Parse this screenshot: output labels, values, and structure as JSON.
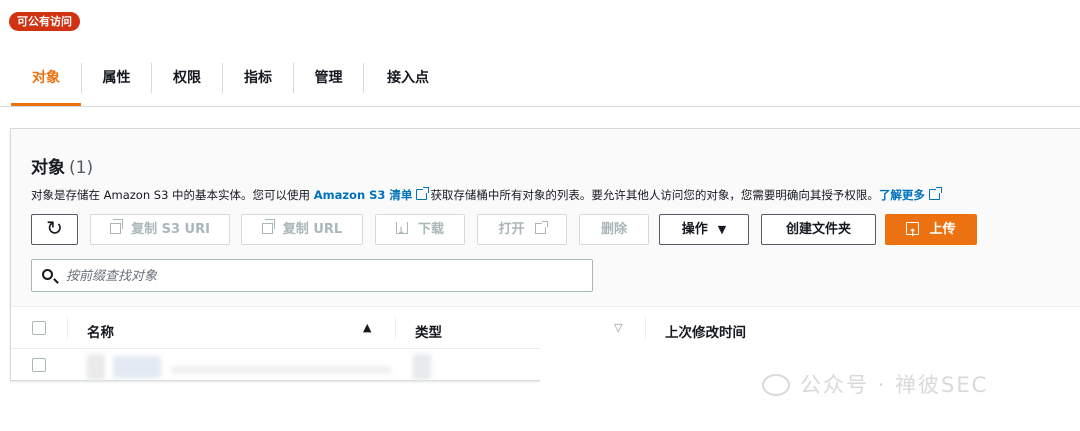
{
  "badge": {
    "label": "可公有访问"
  },
  "tabs": [
    {
      "label": "对象",
      "active": true
    },
    {
      "label": "属性"
    },
    {
      "label": "权限"
    },
    {
      "label": "指标"
    },
    {
      "label": "管理"
    },
    {
      "label": "接入点"
    }
  ],
  "objects": {
    "title": "对象",
    "count": "(1)",
    "description": {
      "prefix": "对象是存储在 Amazon S3 中的基本实体。您可以使用",
      "link1": "Amazon S3 清单",
      "middle": "获取存储桶中所有对象的列表。要允许其他人访问您的对象，您需要明确向其授予权限。",
      "link2": "了解更多"
    },
    "toolbar": {
      "refresh_icon": "↻",
      "copy_s3_uri": "复制 S3 URI",
      "copy_url": "复制 URL",
      "download": "下载",
      "open": "打开",
      "delete": "删除",
      "actions": "操作",
      "actions_caret": "▼",
      "create_folder": "创建文件夹",
      "upload": "上传"
    },
    "search": {
      "placeholder": "按前缀查找对象",
      "value": ""
    },
    "table": {
      "columns": [
        "名称",
        "类型",
        "上次修改时间"
      ],
      "sort_asc_icon": "▲",
      "sort_muted_icon": "▽",
      "rows": 1
    }
  },
  "watermark": {
    "text": "公众号 · 禅彼SEC"
  },
  "colors": {
    "accent": "#ec7211",
    "badge": "#d13212",
    "link": "#0073bb",
    "border": "#aab7b8"
  }
}
